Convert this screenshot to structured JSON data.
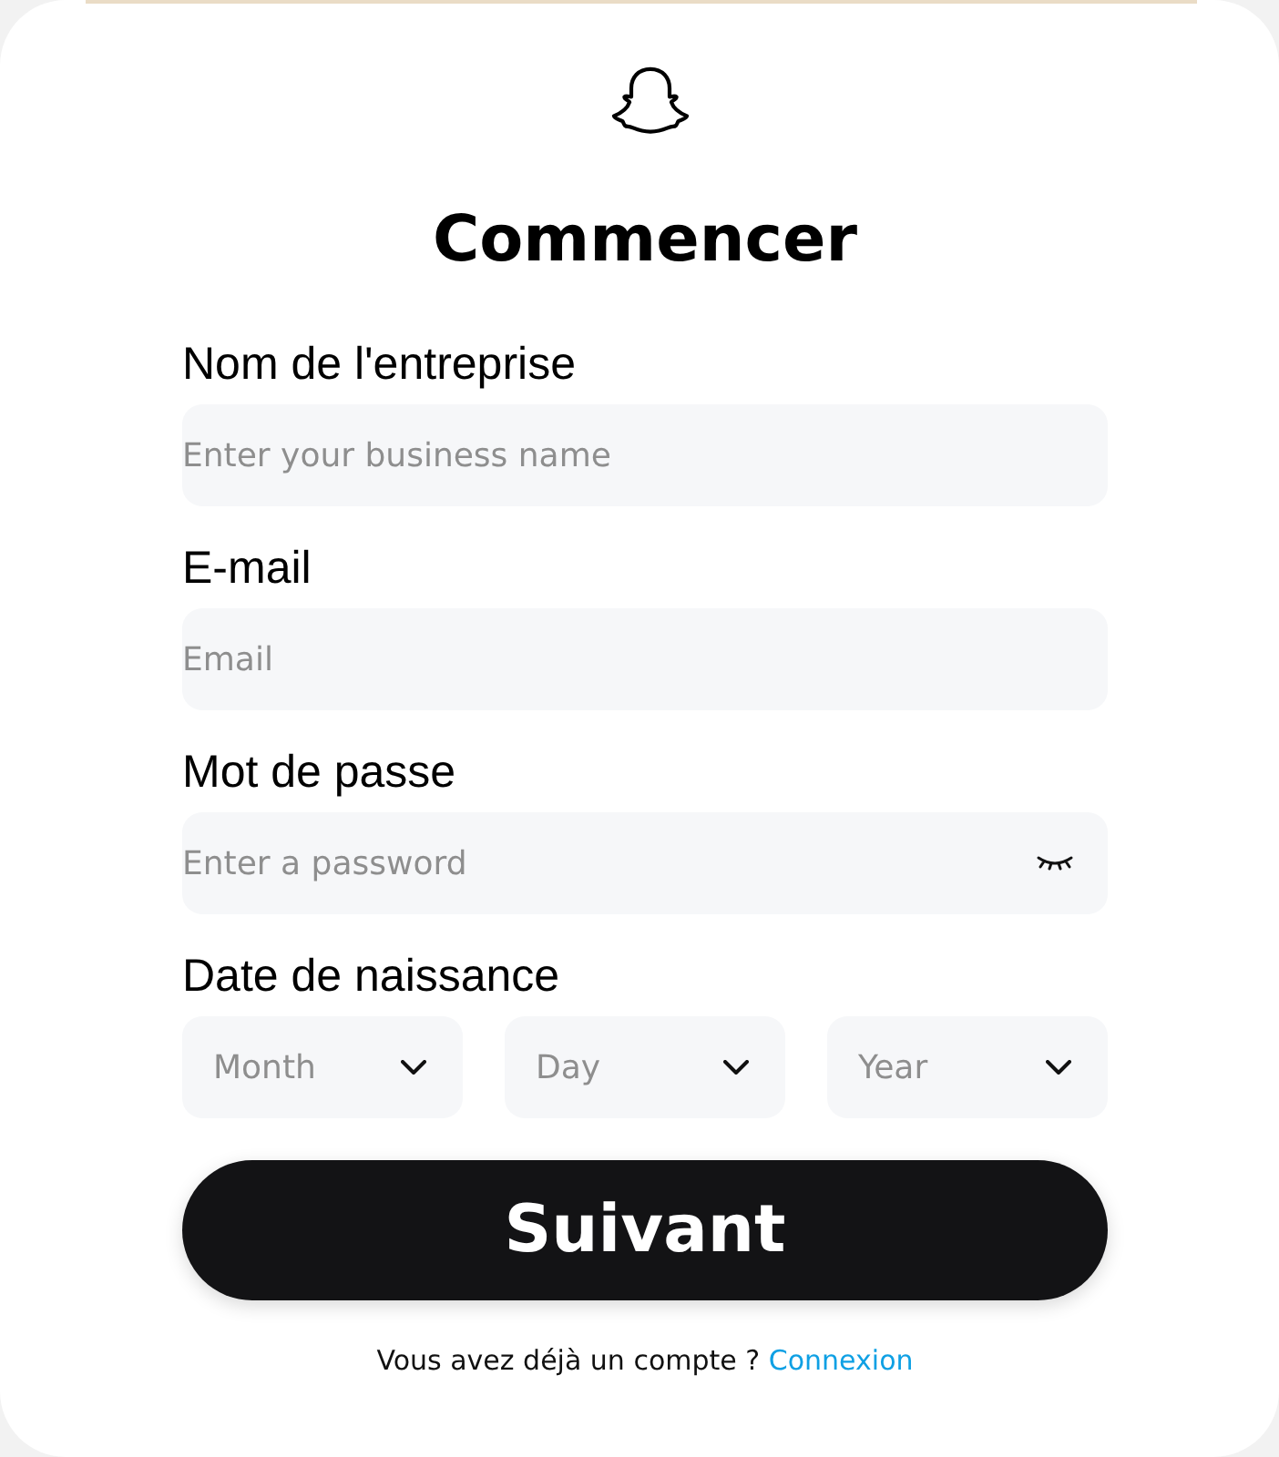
{
  "title": "Commencer",
  "fields": [
    {
      "kind": "text",
      "label": "Nom de l'entreprise",
      "placeholder": "Enter your business name"
    },
    {
      "kind": "text",
      "label": "E-mail",
      "placeholder": "Email"
    },
    {
      "kind": "password",
      "label": "Mot de passe",
      "placeholder": "Enter a password"
    },
    {
      "kind": "date",
      "label": "Date de naissance",
      "selects": [
        "Month",
        "Day",
        "Year"
      ]
    }
  ],
  "submit": "Suivant",
  "footer": {
    "text": "Vous avez déjà un compte ?",
    "link": "Connexion"
  }
}
